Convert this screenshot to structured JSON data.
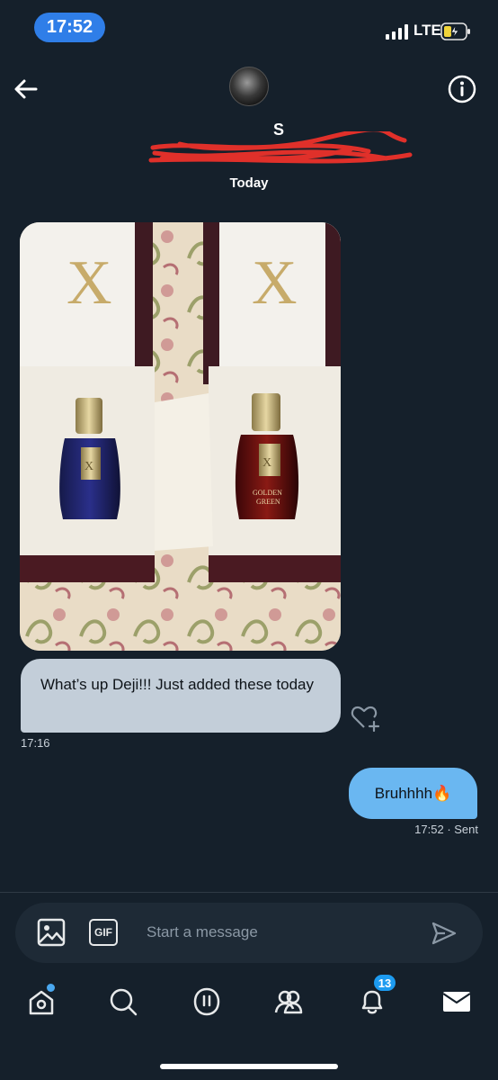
{
  "status_bar": {
    "time": "17:52",
    "network": "LTE"
  },
  "header": {
    "profile_name": "S",
    "info_icon": "info-icon",
    "back_icon": "arrow-left-icon"
  },
  "conversation": {
    "date_separator": "Today",
    "received": {
      "image_description_icon": "photo-icon",
      "text": "What’s up Deji!!! Just added these today",
      "time": "17:16"
    },
    "sent": {
      "text": "Bruhhhh🔥",
      "time": "17:52",
      "status": "· Sent"
    }
  },
  "composer": {
    "placeholder": "Start a message",
    "gif_label": "GIF"
  },
  "tabbar": {
    "notifications_count": "13"
  },
  "colors": {
    "background": "#15202b",
    "sent_bubble": "#6ab7f1",
    "received_bubble": "#c3ced9",
    "accent": "#1d9bf0"
  }
}
